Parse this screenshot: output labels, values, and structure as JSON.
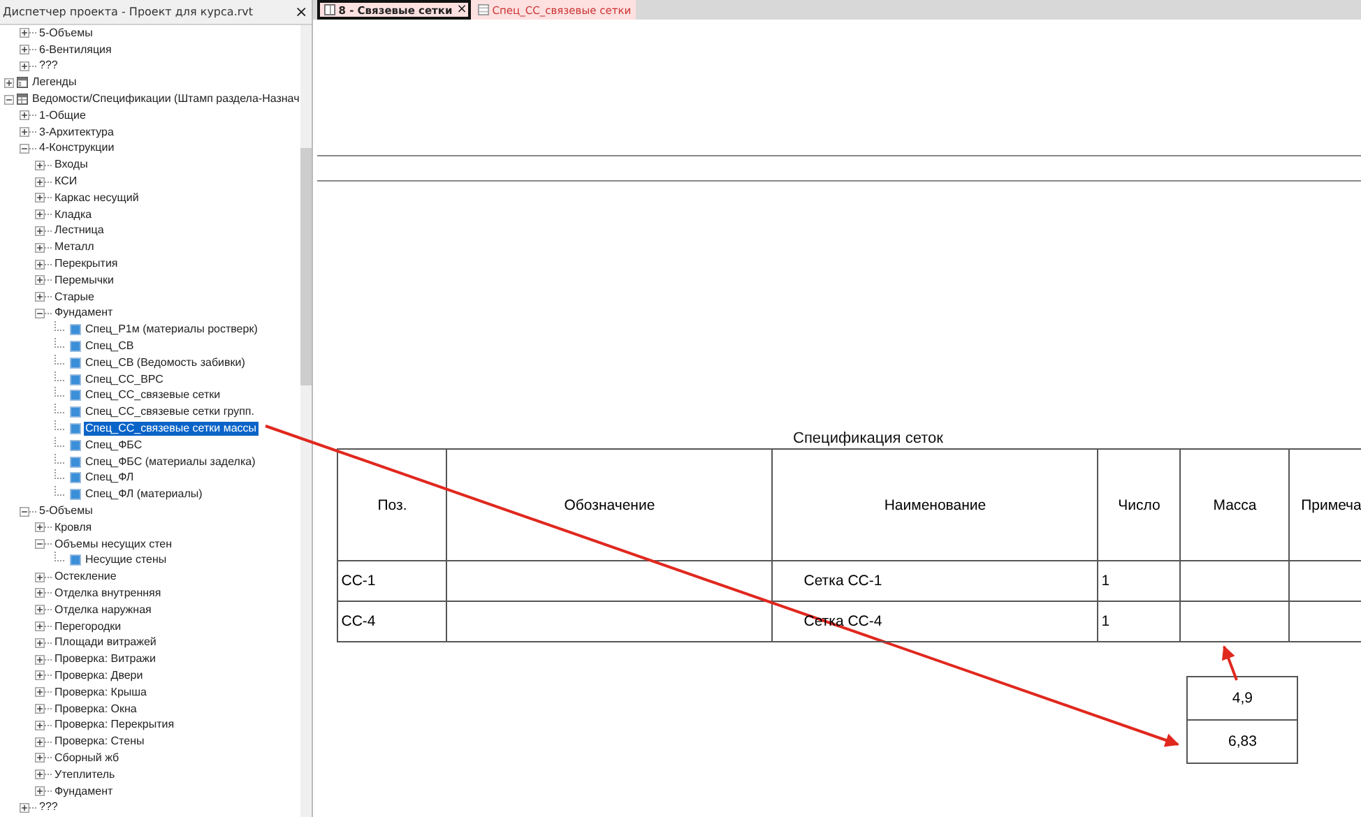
{
  "project_browser": {
    "title": "Диспетчер проекта - Проект для курса.rvt",
    "close": "×",
    "continued_items": [
      {
        "label": "5-Объемы",
        "kind": "group",
        "expanded": false
      },
      {
        "label": "6-Вентиляция",
        "kind": "group",
        "expanded": false
      },
      {
        "label": "???",
        "kind": "group",
        "expanded": false
      }
    ],
    "tree": [
      {
        "label": "Легенды",
        "kind": "legends",
        "expanded": false
      },
      {
        "label": "Ведомости/Спецификации (Штамп раздела-Назнач",
        "kind": "schedules",
        "expanded": true,
        "children": [
          {
            "label": "1-Общие",
            "kind": "group",
            "expanded": false
          },
          {
            "label": "3-Архитектура",
            "kind": "group",
            "expanded": false
          },
          {
            "label": "4-Конструкции",
            "kind": "group",
            "expanded": true,
            "children": [
              {
                "label": "Входы",
                "kind": "group",
                "expanded": false
              },
              {
                "label": "КСИ",
                "kind": "group",
                "expanded": false
              },
              {
                "label": "Каркас несущий",
                "kind": "group",
                "expanded": false
              },
              {
                "label": "Кладка",
                "kind": "group",
                "expanded": false
              },
              {
                "label": "Лестница",
                "kind": "group",
                "expanded": false
              },
              {
                "label": "Металл",
                "kind": "group",
                "expanded": false
              },
              {
                "label": "Перекрытия",
                "kind": "group",
                "expanded": false
              },
              {
                "label": "Перемычки",
                "kind": "group",
                "expanded": false
              },
              {
                "label": "Старые",
                "kind": "group",
                "expanded": false
              },
              {
                "label": "Фундамент",
                "kind": "group",
                "expanded": true,
                "children": [
                  {
                    "label": "Спец_Р1м (материалы ростверк)",
                    "kind": "schedule",
                    "selected": false
                  },
                  {
                    "label": "Спец_СВ",
                    "kind": "schedule",
                    "selected": false
                  },
                  {
                    "label": "Спец_СВ (Ведомость забивки)",
                    "kind": "schedule",
                    "selected": false
                  },
                  {
                    "label": "Спец_СС_ВРС",
                    "kind": "schedule",
                    "selected": false
                  },
                  {
                    "label": "Спец_СС_связевые сетки",
                    "kind": "schedule",
                    "selected": false
                  },
                  {
                    "label": "Спец_СС_связевые сетки групп.",
                    "kind": "schedule",
                    "selected": false
                  },
                  {
                    "label": "Спец_СС_связевые сетки массы",
                    "kind": "schedule",
                    "selected": true
                  },
                  {
                    "label": "Спец_ФБС",
                    "kind": "schedule",
                    "selected": false
                  },
                  {
                    "label": "Спец_ФБС (материалы заделка)",
                    "kind": "schedule",
                    "selected": false
                  },
                  {
                    "label": "Спец_ФЛ",
                    "kind": "schedule",
                    "selected": false
                  },
                  {
                    "label": "Спец_ФЛ (материалы)",
                    "kind": "schedule",
                    "selected": false
                  }
                ]
              }
            ]
          },
          {
            "label": "5-Объемы",
            "kind": "group",
            "expanded": true,
            "children": [
              {
                "label": "Кровля",
                "kind": "group",
                "expanded": false
              },
              {
                "label": "Объемы несущих стен",
                "kind": "group",
                "expanded": true,
                "children": [
                  {
                    "label": "Несущие стены",
                    "kind": "schedule",
                    "selected": false
                  }
                ]
              },
              {
                "label": "Остекление",
                "kind": "group",
                "expanded": false
              },
              {
                "label": "Отделка внутренняя",
                "kind": "group",
                "expanded": false
              },
              {
                "label": "Отделка наружная",
                "kind": "group",
                "expanded": false
              },
              {
                "label": "Перегородки",
                "kind": "group",
                "expanded": false
              },
              {
                "label": "Площади витражей",
                "kind": "group",
                "expanded": false
              },
              {
                "label": "Проверка: Витражи",
                "kind": "group",
                "expanded": false
              },
              {
                "label": "Проверка: Двери",
                "kind": "group",
                "expanded": false
              },
              {
                "label": "Проверка: Крыша",
                "kind": "group",
                "expanded": false
              },
              {
                "label": "Проверка: Окна",
                "kind": "group",
                "expanded": false
              },
              {
                "label": "Проверка: Перекрытия",
                "kind": "group",
                "expanded": false
              },
              {
                "label": "Проверка: Стены",
                "kind": "group",
                "expanded": false
              },
              {
                "label": "Сборный жб",
                "kind": "group",
                "expanded": false
              },
              {
                "label": "Утеплитель",
                "kind": "group",
                "expanded": false
              },
              {
                "label": "Фундамент",
                "kind": "group",
                "expanded": false
              }
            ]
          },
          {
            "label": "???",
            "kind": "group",
            "expanded": false
          }
        ]
      }
    ]
  },
  "tabs": [
    {
      "label": "8 - Связевые сетки",
      "kind": "sheet",
      "selected": true,
      "close": "×"
    },
    {
      "label": "Спец_СС_связевые сетки",
      "kind": "schedule",
      "selected": false
    }
  ],
  "schedule": {
    "title": "Спецификация сеток",
    "columns": [
      "Поз.",
      "Обозначение",
      "Наименование",
      "Число",
      "Масса",
      "Примеча"
    ],
    "rows": [
      {
        "position": "СС-1",
        "name": "Сетка СС-1",
        "count": "1"
      },
      {
        "position": "СС-4",
        "name": "Сетка СС-4",
        "count": "1"
      }
    ]
  },
  "mass_values": [
    "4,9",
    "6,83"
  ]
}
